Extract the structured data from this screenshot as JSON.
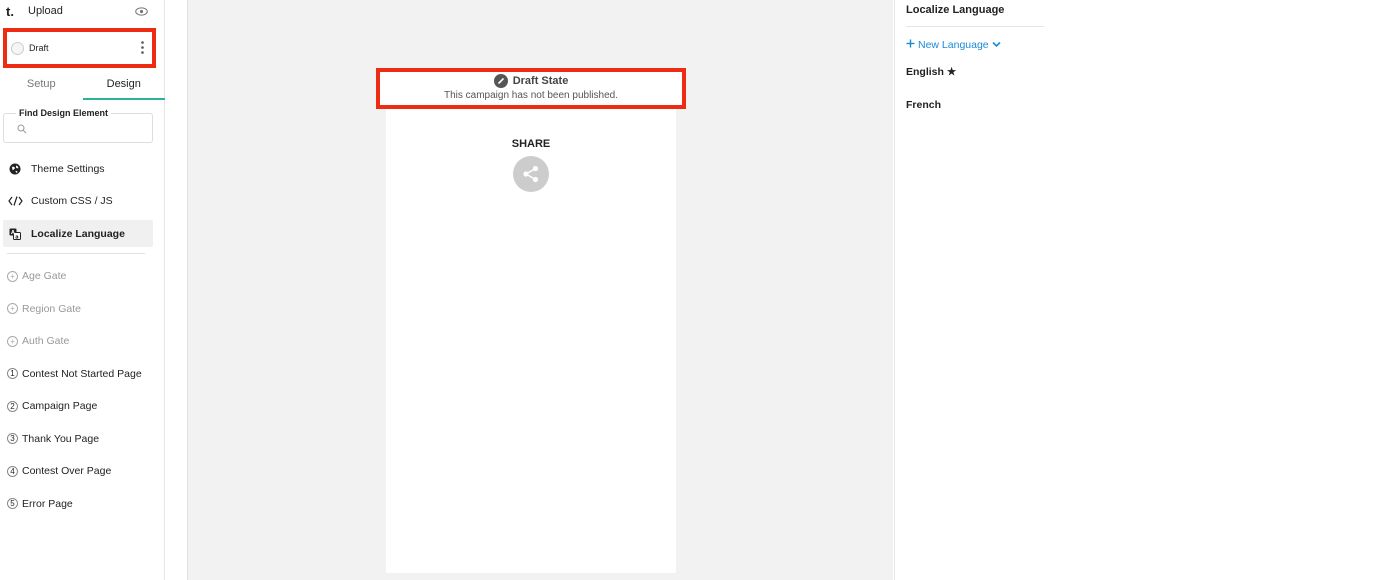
{
  "topbar": {
    "logo": "t.",
    "upload_label": "Upload",
    "preview_icon": "eye-icon"
  },
  "draft": {
    "label": "Draft",
    "menu_icon": "kebab-menu-icon"
  },
  "tabs": [
    {
      "label": "Setup",
      "active": false
    },
    {
      "label": "Design",
      "active": true
    }
  ],
  "find": {
    "label": "Find Design Element",
    "placeholder": ""
  },
  "nav": {
    "items": [
      {
        "label": "Theme Settings",
        "icon": "globe-icon"
      },
      {
        "label": "Custom CSS / JS",
        "icon": "code-icon"
      },
      {
        "label": "Localize Language",
        "icon": "translate-icon",
        "active": true
      }
    ]
  },
  "pages": {
    "items": [
      {
        "marker": "+",
        "label": "Age Gate"
      },
      {
        "marker": "+",
        "label": "Region Gate"
      },
      {
        "marker": "+",
        "label": "Auth Gate"
      },
      {
        "marker": "1",
        "label": "Contest Not Started Page"
      },
      {
        "marker": "2",
        "label": "Campaign Page"
      },
      {
        "marker": "3",
        "label": "Thank You Page"
      },
      {
        "marker": "4",
        "label": "Contest Over Page"
      },
      {
        "marker": "5",
        "label": "Error Page"
      }
    ]
  },
  "canvas": {
    "banner_title": "Draft State",
    "banner_sub": "This campaign has not been published.",
    "share_label": "SHARE"
  },
  "right": {
    "title": "Localize Language",
    "new_language": "New Language",
    "languages": [
      {
        "label": "English ★"
      },
      {
        "label": "French"
      }
    ]
  },
  "colors": {
    "highlight": "#ee2b13",
    "accent": "#2bb39a",
    "link": "#1b8bd6"
  }
}
